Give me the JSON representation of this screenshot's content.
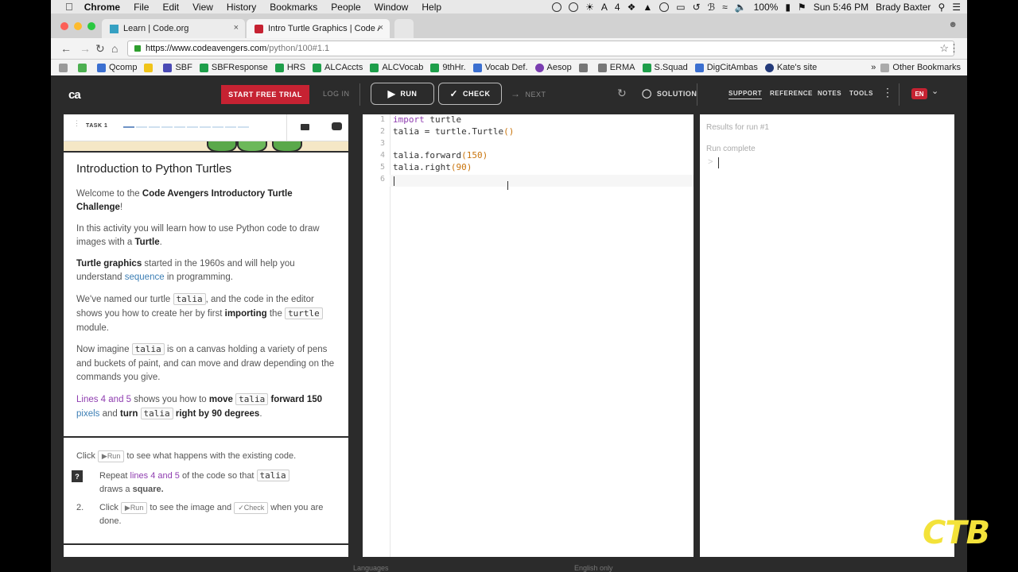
{
  "menubar": {
    "app": "Chrome",
    "items": [
      "File",
      "Edit",
      "View",
      "History",
      "Bookmarks",
      "People",
      "Window",
      "Help"
    ],
    "battery": "100%",
    "adobe_count": "4",
    "clock": "Sun 5:46 PM",
    "user": "Brady Baxter"
  },
  "tabs": [
    {
      "title": "Learn | Code.org"
    },
    {
      "title": "Intro Turtle Graphics | Code A"
    }
  ],
  "address": {
    "url_main": "https://www.codeavengers.com",
    "url_rest": "/python/100#1.1"
  },
  "bookmarks": [
    "Qcomp",
    "SBF",
    "SBFResponse",
    "HRS",
    "ALCAccts",
    "ALCVocab",
    "9thHr.",
    "Vocab Def.",
    "Aesop",
    "ERMA",
    "S.Squad",
    "DigCitAmbas",
    "Kate's site"
  ],
  "other_bookmarks": "Other Bookmarks",
  "toolbar": {
    "logo": "ca",
    "trial": "START FREE TRIAL",
    "login": "LOG IN",
    "run": "RUN",
    "check": "CHECK",
    "next": "NEXT",
    "solution": "SOLUTION",
    "support": "SUPPORT",
    "reference": "REFERENCE",
    "notes": "NOTES",
    "tools": "TOOLS",
    "lang": "EN"
  },
  "task": {
    "label": "TASK 1",
    "progress_current": 1,
    "progress_total": 10
  },
  "lesson": {
    "title": "Introduction to Python Turtles",
    "p1a": "Welcome to the ",
    "p1b": "Code Avengers Introductory Turtle Challenge",
    "p1c": "!",
    "p2a": "In this activity you will learn how to use Python code to draw images with a ",
    "p2b": "Turtle",
    "p2c": ".",
    "p3a": "Turtle graphics",
    "p3b": " started in the 1960s and will help you understand ",
    "p3c": "sequence",
    "p3d": " in programming.",
    "p4a": "We've named our turtle ",
    "p4b": "talia",
    "p4c": ", and the code in the editor shows you how to create her by first ",
    "p4d": "importing",
    "p4e": " the ",
    "p4f": "turtle",
    "p4g": " module.",
    "p5a": "Now imagine ",
    "p5b": "talia",
    "p5c": " is on a canvas holding a variety of pens and buckets of paint, and can move and draw depending on the commands you give.",
    "p6a": "Lines 4 and 5",
    "p6b": " shows you how to ",
    "p6c": "move",
    "p6d": "talia",
    "p6e": "forward 150",
    "p6f": "pixels",
    "p6g": " and ",
    "p6h": "turn",
    "p6i": "talia",
    "p6j": "right by 90 degrees",
    "p6k": "."
  },
  "instructions": {
    "click1": "Click ",
    "run_btn": "Run",
    "click1b": " to see what happens with the existing code.",
    "help": "?",
    "step1_num": "1.",
    "step1a": "Repeat ",
    "step1b": "lines 4 and 5",
    "step1c": " of the code so that ",
    "step1d": "talia",
    "step1e": "draws a ",
    "step1f": "square.",
    "step2_num": "2.",
    "step2a": "Click ",
    "step2b": "Run",
    "step2c": " to see the image and ",
    "step2d": "Check",
    "step2e": " when you are done."
  },
  "editor": {
    "line_numbers": [
      "1",
      "2",
      "3",
      "4",
      "5",
      "6"
    ],
    "l1_kw": "import",
    "l1_rest": " turtle",
    "l2_a": "talia = turtle.Turtle",
    "l2_b": "()",
    "l4_a": "talia.forward",
    "l4_b": "(",
    "l4_c": "150",
    "l4_d": ")",
    "l5_a": "talia.right",
    "l5_b": "(",
    "l5_c": "90",
    "l5_d": ")"
  },
  "results": {
    "title": "Results for run #1",
    "status": "Run complete",
    "prompt": ">"
  },
  "footer": {
    "left": "Languages",
    "right": "English only"
  },
  "watermark": "CTB",
  "colors": {
    "accent": "#c62232",
    "keyword": "#8f3db0",
    "number": "#c9740c",
    "link": "#3d7fb5"
  }
}
